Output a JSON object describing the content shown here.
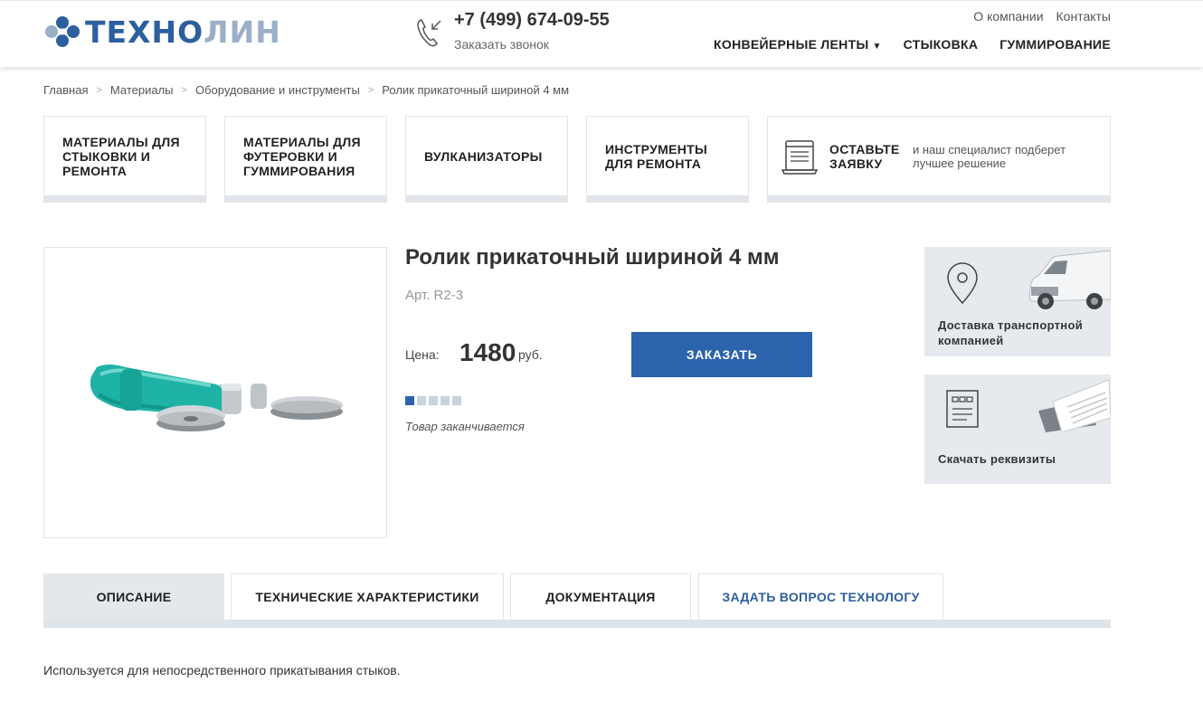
{
  "header": {
    "logo": {
      "text_dark": "ТЕХНО",
      "text_light": "ЛИН"
    },
    "phone": "+7 (499) 674-09-55",
    "callback": "Заказать звонок",
    "top_links": [
      "О компании",
      "Контакты"
    ],
    "nav": [
      {
        "label": "КОНВЕЙЕРНЫЕ ЛЕНТЫ",
        "dropdown": true
      },
      {
        "label": "СТЫКОВКА"
      },
      {
        "label": "ГУММИРОВАНИЕ"
      }
    ]
  },
  "breadcrumb": [
    "Главная",
    "Материалы",
    "Оборудование и инструменты",
    "Ролик прикаточный шириной 4 мм"
  ],
  "categories": [
    {
      "lines": [
        "МАТЕРИАЛЫ ДЛЯ",
        "СТЫКОВКИ И",
        "РЕМОНТА"
      ]
    },
    {
      "lines": [
        "МАТЕРИАЛЫ ДЛЯ",
        "ФУТЕРОВКИ И",
        "ГУММИРОВАНИЯ"
      ]
    },
    {
      "lines": [
        "ВУЛКАНИЗАТОРЫ"
      ]
    },
    {
      "lines": [
        "ИНСТРУМЕНТЫ",
        "ДЛЯ РЕМОНТА"
      ]
    }
  ],
  "request": {
    "title_lines": [
      "ОСТАВЬТЕ",
      "ЗАЯВКУ"
    ],
    "text_lines": [
      "и наш специалист подберет",
      "лучшее решение"
    ]
  },
  "product": {
    "title": "Ролик прикаточный шириной 4 мм",
    "sku": "Арт. R2-3",
    "price_label": "Цена:",
    "price": "1480",
    "currency": "руб.",
    "order_button": "ЗАКАЗАТЬ",
    "stock_level": 1,
    "stock_max": 5,
    "stock_text": "Товар заканчивается"
  },
  "side": {
    "delivery_lines": [
      "Доставка транспортной",
      "компанией"
    ],
    "requisites": "Скачать реквизиты"
  },
  "tabs": [
    {
      "label": "ОПИСАНИЕ",
      "active": true
    },
    {
      "label": "ТЕХНИЧЕСКИЕ ХАРАКТЕРИСТИКИ"
    },
    {
      "label": "ДОКУМЕНТАЦИЯ"
    },
    {
      "label": "ЗАДАТЬ ВОПРОС ТЕХНОЛОГУ"
    }
  ],
  "description": "Используется для непосредственного прикатывания стыков.",
  "colors": {
    "brand": "#2c5f9e",
    "button": "#2b63ad",
    "handle": "#1fb2a6"
  }
}
